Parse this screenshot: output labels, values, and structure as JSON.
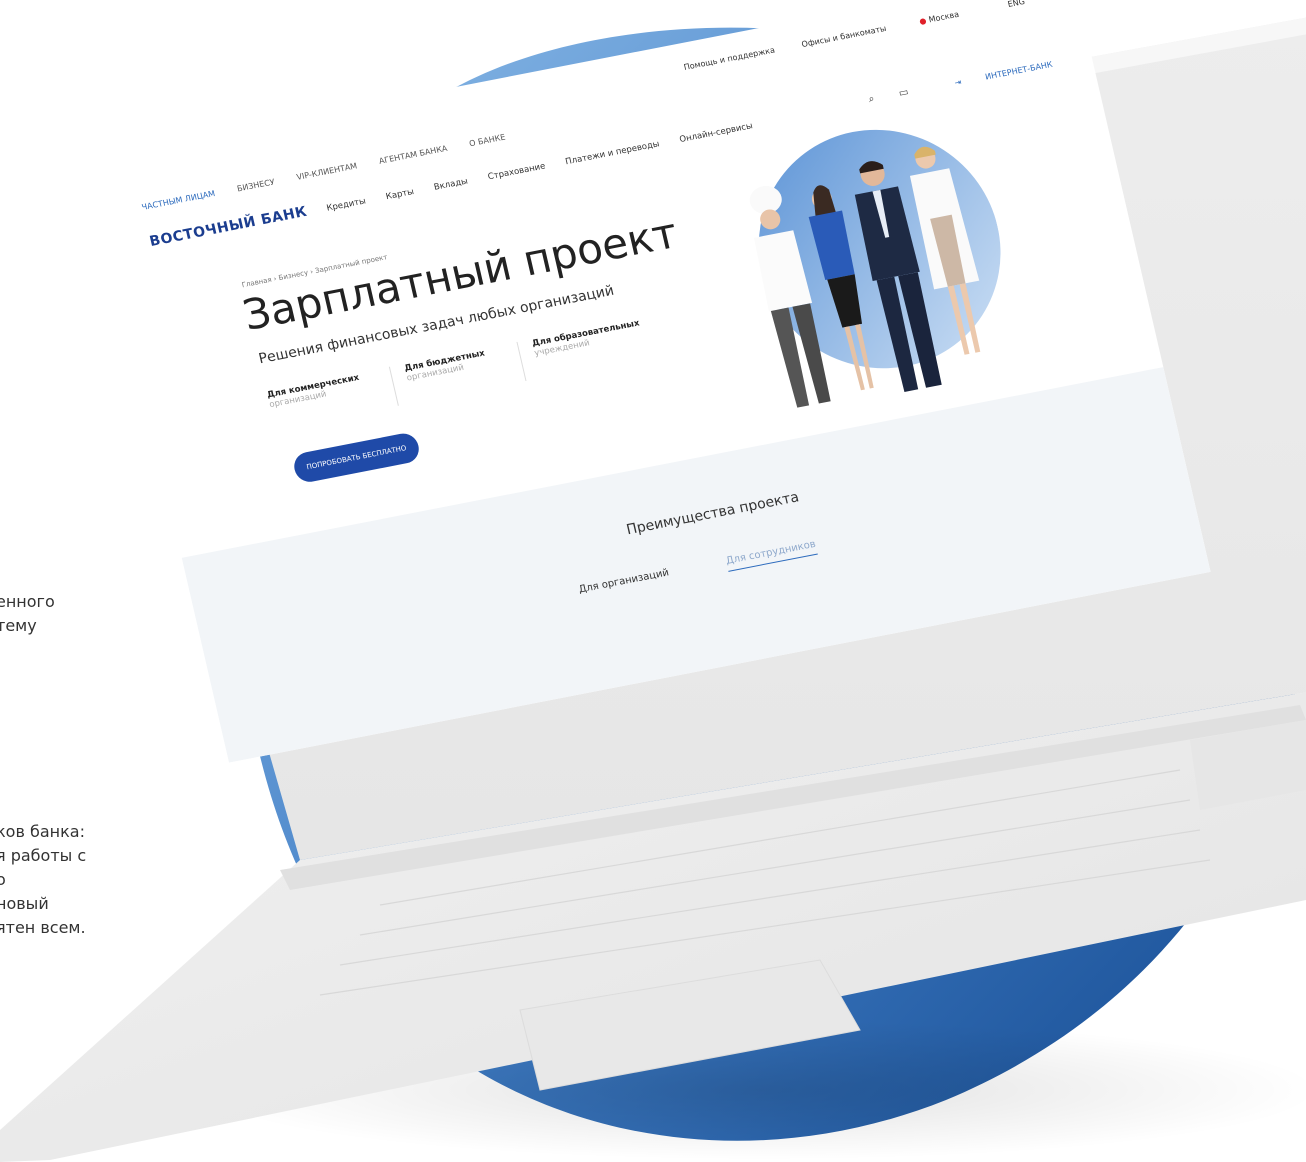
{
  "side_text_1": [
    "енного",
    "тему"
  ],
  "side_text_2": [
    "ков банка:",
    "я работы с",
    "о",
    "новый",
    "ятен всем."
  ],
  "site": {
    "topbar": {
      "help": "Помощь и поддержка",
      "offices": "Офисы и банкоматы",
      "city": "Москва",
      "lang": "ENG"
    },
    "segment_nav": [
      "ЧАСТНЫМ ЛИЦАМ",
      "БИЗНЕСУ",
      "VIP-КЛИЕНТАМ",
      "АГЕНТАМ БАНКА",
      "О БАНКЕ"
    ],
    "logo": "ВОСТОЧНЫЙ БАНК",
    "main_nav": [
      "Кредиты",
      "Карты",
      "Вклады",
      "Страхование",
      "Платежи и переводы",
      "Онлайн-сервисы"
    ],
    "cabinet": "ИНТЕРНЕТ-БАНК",
    "breadcrumb": "Главная  ›  Бизнесу  ›  Зарплатный проект",
    "hero": {
      "title": "Зарплатный проект",
      "subtitle": "Решения финансовых задач любых организаций",
      "segments": [
        {
          "title": "Для коммерческих",
          "sub": "организаций"
        },
        {
          "title": "Для бюджетных",
          "sub": "организаций"
        },
        {
          "title": "Для образовательных",
          "sub": "учреждений"
        }
      ],
      "cta": "ПОПРОБОВАТЬ БЕСПЛАТНО"
    },
    "advantages": {
      "title": "Преимущества проекта",
      "tab_org": "Для организаций",
      "tab_emp": "Для сотрудников"
    }
  },
  "colors": {
    "blob_dark": "#1c5aa6",
    "blob_light": "#7aaee0",
    "laptop_body": "#efefef",
    "brand": "#1b3d8f",
    "cta": "#1f4aa8"
  }
}
